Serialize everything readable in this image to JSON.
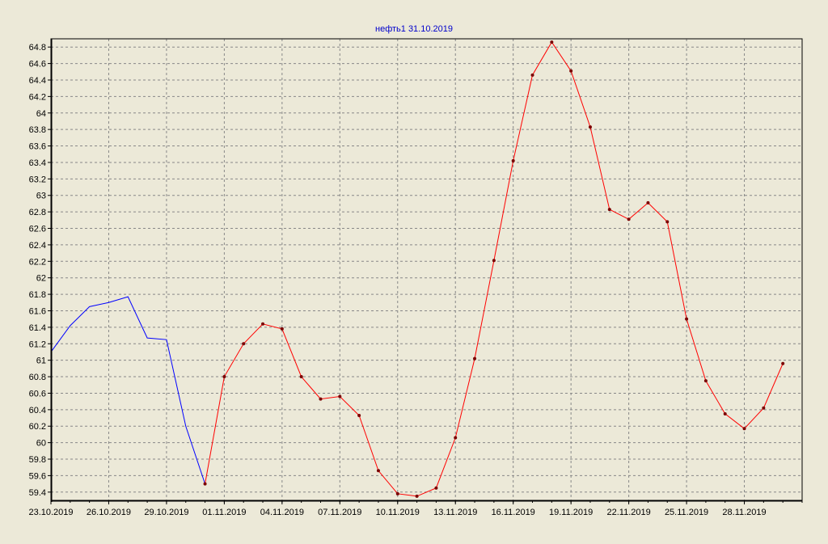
{
  "chart_data": {
    "type": "line",
    "title": "нефть1 31.10.2019",
    "xlabel": "",
    "ylabel": "",
    "ylim": [
      59.3,
      64.9
    ],
    "yticks": [
      59.4,
      59.6,
      59.8,
      60,
      60.2,
      60.4,
      60.6,
      60.8,
      61,
      61.2,
      61.4,
      61.6,
      61.8,
      62,
      62.2,
      62.4,
      62.6,
      62.8,
      63,
      63.2,
      63.4,
      63.6,
      63.8,
      64,
      64.2,
      64.4,
      64.6,
      64.8
    ],
    "x_range": [
      "2019-10-23",
      "2019-12-01"
    ],
    "xticks": [
      {
        "date": "2019-10-23",
        "label": "23.10.2019"
      },
      {
        "date": "2019-10-26",
        "label": "26.10.2019"
      },
      {
        "date": "2019-10-29",
        "label": "29.10.2019"
      },
      {
        "date": "2019-11-01",
        "label": "01.11.2019"
      },
      {
        "date": "2019-11-04",
        "label": "04.11.2019"
      },
      {
        "date": "2019-11-07",
        "label": "07.11.2019"
      },
      {
        "date": "2019-11-10",
        "label": "10.11.2019"
      },
      {
        "date": "2019-11-13",
        "label": "13.11.2019"
      },
      {
        "date": "2019-11-16",
        "label": "16.11.2019"
      },
      {
        "date": "2019-11-19",
        "label": "19.11.2019"
      },
      {
        "date": "2019-11-22",
        "label": "22.11.2019"
      },
      {
        "date": "2019-11-25",
        "label": "25.11.2019"
      },
      {
        "date": "2019-11-28",
        "label": "28.11.2019"
      }
    ],
    "grid": true,
    "legend": "none",
    "series": [
      {
        "color": "#0000ff",
        "markers": false,
        "points": [
          {
            "x": "2019-10-23",
            "y": 61.1
          },
          {
            "x": "2019-10-24",
            "y": 61.42
          },
          {
            "x": "2019-10-25",
            "y": 61.65
          },
          {
            "x": "2019-10-26",
            "y": 61.7
          },
          {
            "x": "2019-10-27",
            "y": 61.77
          },
          {
            "x": "2019-10-28",
            "y": 61.27
          },
          {
            "x": "2019-10-29",
            "y": 61.25
          },
          {
            "x": "2019-10-30",
            "y": 60.2
          },
          {
            "x": "2019-10-31",
            "y": 59.5
          }
        ]
      },
      {
        "color": "#ff0000",
        "markers": true,
        "points": [
          {
            "x": "2019-10-31",
            "y": 59.5
          },
          {
            "x": "2019-11-01",
            "y": 60.8
          },
          {
            "x": "2019-11-02",
            "y": 61.2
          },
          {
            "x": "2019-11-03",
            "y": 61.44
          },
          {
            "x": "2019-11-04",
            "y": 61.38
          },
          {
            "x": "2019-11-05",
            "y": 60.8
          },
          {
            "x": "2019-11-06",
            "y": 60.53
          },
          {
            "x": "2019-11-07",
            "y": 60.56
          },
          {
            "x": "2019-11-08",
            "y": 60.33
          },
          {
            "x": "2019-11-09",
            "y": 59.66
          },
          {
            "x": "2019-11-10",
            "y": 59.38
          },
          {
            "x": "2019-11-11",
            "y": 59.35
          },
          {
            "x": "2019-11-12",
            "y": 59.45
          },
          {
            "x": "2019-11-13",
            "y": 60.06
          },
          {
            "x": "2019-11-14",
            "y": 61.02
          },
          {
            "x": "2019-11-15",
            "y": 62.21
          },
          {
            "x": "2019-11-16",
            "y": 63.42
          },
          {
            "x": "2019-11-17",
            "y": 64.46
          },
          {
            "x": "2019-11-18",
            "y": 64.86
          },
          {
            "x": "2019-11-19",
            "y": 64.51
          },
          {
            "x": "2019-11-20",
            "y": 63.83
          },
          {
            "x": "2019-11-21",
            "y": 62.83
          },
          {
            "x": "2019-11-22",
            "y": 62.71
          },
          {
            "x": "2019-11-23",
            "y": 62.91
          },
          {
            "x": "2019-11-24",
            "y": 62.68
          },
          {
            "x": "2019-11-25",
            "y": 61.5
          },
          {
            "x": "2019-11-26",
            "y": 60.75
          },
          {
            "x": "2019-11-27",
            "y": 60.35
          },
          {
            "x": "2019-11-28",
            "y": 60.17
          },
          {
            "x": "2019-11-29",
            "y": 60.42
          },
          {
            "x": "2019-11-30",
            "y": 60.96
          }
        ]
      }
    ],
    "colors": {
      "background": "#ece9d8",
      "plot_background": "#ece9d8",
      "grid": "#888888",
      "axis": "#000000",
      "title": "#0000cc",
      "marker": "#7a0000"
    }
  }
}
